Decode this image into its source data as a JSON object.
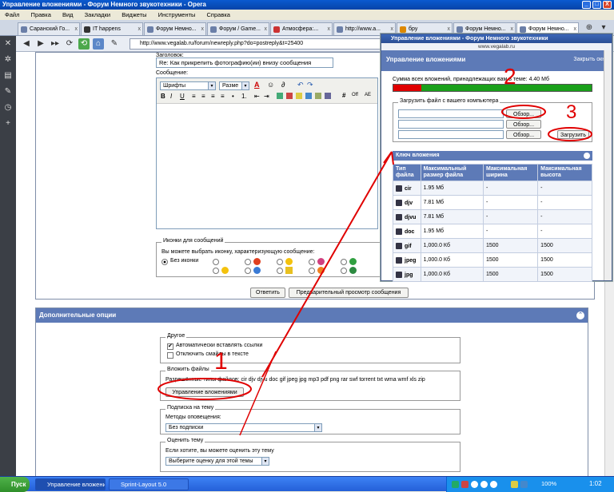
{
  "window": {
    "title": "Управление вложениями - Форум Немного звукотехники - Opera",
    "btn_min": "_",
    "btn_max": "□",
    "btn_close": "X"
  },
  "menu": [
    "Файл",
    "Правка",
    "Вид",
    "Закладки",
    "Виджеты",
    "Инструменты",
    "Справка"
  ],
  "tabs": [
    "Саранский Го...",
    "IT happens",
    "Форум Немно...",
    "Форум / Game...",
    "Атмосфера:...",
    "http://www.a...",
    "бру",
    "Форум Немно...",
    "Форум Немно..."
  ],
  "address": {
    "url": "http://www.vegalab.ru/forum/newreply.php?do=postreply&t=25400"
  },
  "sidebar_icons": [
    "tools-icon",
    "gear-icon",
    "panels-icon",
    "brush-icon",
    "clock-icon",
    "plus-icon"
  ],
  "reply_form": {
    "title_label": "Заголовок:",
    "title_value": "Re: Как прикрепить фотографию(ии) внизу сообщения",
    "message_label": "Сообщение:",
    "font_select": "Шрифты",
    "size_select": "Разме",
    "editor_buttons": [
      "B",
      "I",
      "U",
      "≡",
      "≡",
      "≡",
      "≡",
      "•",
      "1.",
      "⇤",
      "⇥",
      "#",
      "Off",
      "AE"
    ],
    "icons_legend": "Иконки для сообщений",
    "icons_hint": "Вы можете выбрать иконку, характеризующую сообщение:",
    "no_icon_label": "Без иконки",
    "submit_label": "Ответить",
    "preview_label": "Предварительный просмотр сообщения"
  },
  "options": {
    "header": "Дополнительные опции",
    "collapse_glyph": "⌃",
    "misc_legend": "Другое",
    "auto_links": "Автоматически вставлять ссылки",
    "disable_smilies": "Отключить смайлы в тексте",
    "attach_legend": "Вложить файлы",
    "allowed_types": "Разрешённые типы файлов: cir djv djvu doc gif jpeg jpg mp3 pdf png rar swf torrent txt wma wmf xls zip",
    "manage_attachments": "Управление вложениями",
    "subscribe_legend": "Подписка на тему",
    "notify_label": "Методы оповещения:",
    "notify_value": "Без подписки",
    "rate_legend": "Оценить тему",
    "rate_hint": "Если хотите, вы можете оценить эту тему",
    "rate_value": "Выберите оценку для этой темы"
  },
  "popup": {
    "window_title": "Управление вложениями - Форум Немного звукотехники",
    "site": "www.vegalab.ru",
    "header": "Управление вложениями",
    "close_link": "Закрыть окно",
    "total_label": "Сумма всех вложений, принадлежащих вам в теме:",
    "total_value": "4.40 Мб",
    "usage_fraction": 0.14,
    "usage_color_used": "#e00000",
    "usage_color_free": "#1aa01a",
    "upload_legend": "Загрузить файл с вашего компьютера",
    "browse_label": "Обзор...",
    "upload_label": "Загрузить",
    "key_header": "Ключ вложения",
    "columns": [
      "Тип файла",
      "Максимальный размер файла",
      "Максимальная ширина",
      "Максимальная высота"
    ],
    "rows": [
      [
        "cir",
        "1.95 Мб",
        "-",
        "-"
      ],
      [
        "djv",
        "7.81 Мб",
        "-",
        "-"
      ],
      [
        "djvu",
        "7.81 Мб",
        "-",
        "-"
      ],
      [
        "doc",
        "1.95 Мб",
        "-",
        "-"
      ],
      [
        "gif",
        "1,000.0 Кб",
        "1500",
        "1500"
      ],
      [
        "jpeg",
        "1,000.0 Кб",
        "1500",
        "1500"
      ],
      [
        "jpg",
        "1,000.0 Кб",
        "1500",
        "1500"
      ]
    ]
  },
  "annotations": {
    "num1": "1",
    "num2": "2",
    "num3": "3",
    "color": "#e00000"
  },
  "taskbar": {
    "start": "Пуск",
    "tasks": [
      "Управление вложениями...",
      "Sprint-Layout 5.0"
    ],
    "zoom": "100%",
    "clock": "1:02"
  }
}
